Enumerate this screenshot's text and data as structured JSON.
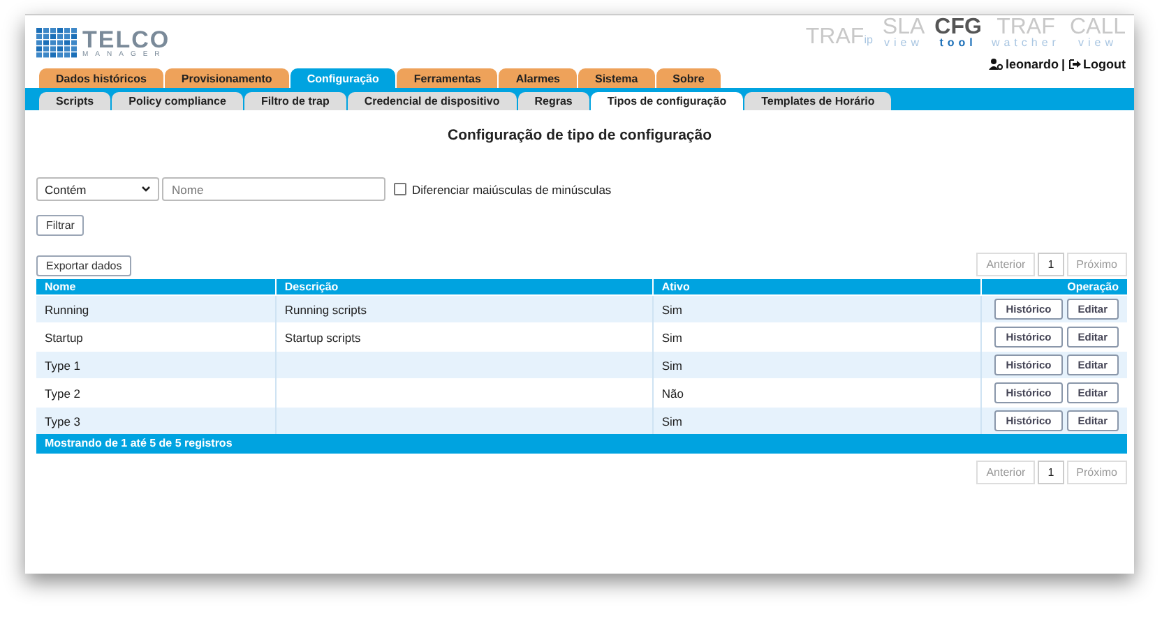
{
  "logo": {
    "title": "TELCO",
    "subtitle": "MANAGER"
  },
  "products": [
    {
      "name": "TRAF",
      "suffix": "ip",
      "selected": false
    },
    {
      "name": "SLA",
      "suffix": "view",
      "selected": false
    },
    {
      "name": "CFG",
      "suffix": "tool",
      "selected": true
    },
    {
      "name": "TRAF",
      "suffix": "watcher",
      "selected": false
    },
    {
      "name": "CALL",
      "suffix": "view",
      "selected": false
    }
  ],
  "user": {
    "name": "leonardo",
    "separator": "|",
    "logout": "Logout"
  },
  "tabs": [
    {
      "label": "Dados históricos",
      "selected": false
    },
    {
      "label": "Provisionamento",
      "selected": false
    },
    {
      "label": "Configuração",
      "selected": true
    },
    {
      "label": "Ferramentas",
      "selected": false
    },
    {
      "label": "Alarmes",
      "selected": false
    },
    {
      "label": "Sistema",
      "selected": false
    },
    {
      "label": "Sobre",
      "selected": false
    }
  ],
  "subtabs": [
    {
      "label": "Scripts",
      "selected": false
    },
    {
      "label": "Policy compliance",
      "selected": false
    },
    {
      "label": "Filtro de trap",
      "selected": false
    },
    {
      "label": "Credencial de dispositivo",
      "selected": false
    },
    {
      "label": "Regras",
      "selected": false
    },
    {
      "label": "Tipos de configuração",
      "selected": true
    },
    {
      "label": "Templates de Horário",
      "selected": false
    }
  ],
  "page_title": "Configuração de tipo de configuração",
  "filter": {
    "match": "Contém",
    "placeholder": "Nome",
    "case_sensitive": {
      "label": "Diferenciar maiúsculas de minúsculas",
      "checked": false
    },
    "button": "Filtrar"
  },
  "export_button": "Exportar dados",
  "pagination_top": {
    "previous": "Anterior",
    "page": "1",
    "next": "Próximo"
  },
  "table": {
    "columns": [
      "Nome",
      "Descrição",
      "Ativo",
      "Operação"
    ],
    "rows": [
      {
        "name": "Running",
        "description": "Running scripts",
        "active": "Sim",
        "actions": [
          "Histórico",
          "Editar"
        ]
      },
      {
        "name": "Startup",
        "description": "Startup scripts",
        "active": "Sim",
        "actions": [
          "Histórico",
          "Editar"
        ]
      },
      {
        "name": "Type 1",
        "active": "Sim",
        "actions": [
          "Histórico",
          "Editar"
        ]
      },
      {
        "name": "Type 2",
        "active": "Não",
        "actions": [
          "Histórico",
          "Editar"
        ]
      },
      {
        "name": "Type 3",
        "active": "Sim",
        "actions": [
          "Histórico",
          "Editar"
        ]
      }
    ],
    "footer": "Mostrando de 1 até 5 de 5 registros"
  },
  "pagination_bottom": {
    "previous": "Anterior",
    "page": "1",
    "next": "Próximo"
  }
}
